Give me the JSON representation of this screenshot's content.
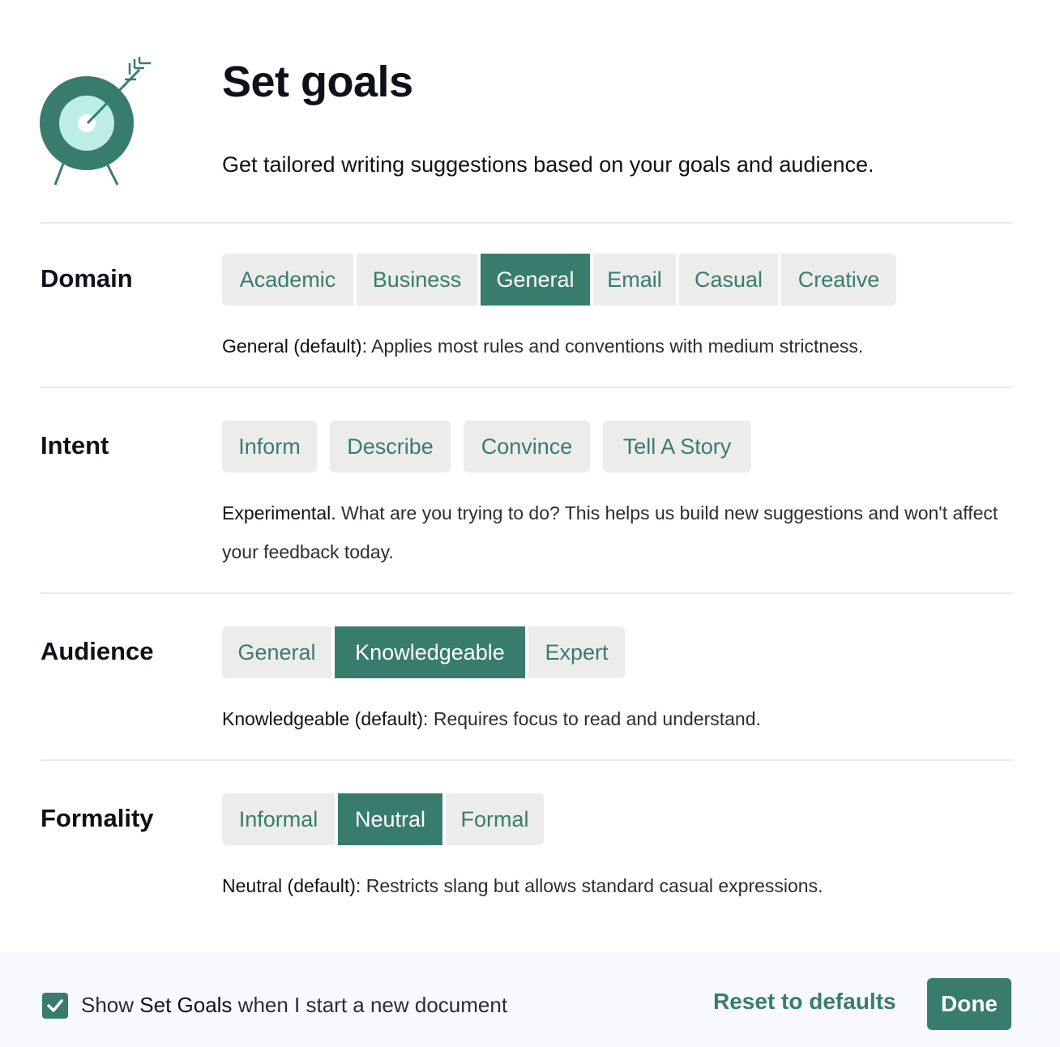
{
  "header": {
    "title": "Set goals",
    "subtitle": "Get tailored writing suggestions based on your goals and audience.",
    "logo_icon": "target-arrow-icon"
  },
  "colors": {
    "accent": "#387c6d",
    "accent_light": "#bdeee6",
    "option_bg": "#ececec",
    "footer_bg": "#f8f9fd",
    "text": "#0e101a"
  },
  "sections": {
    "domain": {
      "label": "Domain",
      "options": [
        "Academic",
        "Business",
        "General",
        "Email",
        "Casual",
        "Creative"
      ],
      "selected": "General",
      "desc_strong": "General (default):",
      "desc_text": " Applies most rules and conventions with medium strictness."
    },
    "intent": {
      "label": "Intent",
      "options": [
        "Inform",
        "Describe",
        "Convince",
        "Tell A Story"
      ],
      "selected": null,
      "desc_strong": "Experimental.",
      "desc_text": " What are you trying to do? This helps us build new suggestions and won't affect your feedback today."
    },
    "audience": {
      "label": "Audience",
      "options": [
        "General",
        "Knowledgeable",
        "Expert"
      ],
      "selected": "Knowledgeable",
      "desc_strong": "Knowledgeable (default):",
      "desc_text": " Requires focus to read and understand."
    },
    "formality": {
      "label": "Formality",
      "options": [
        "Informal",
        "Neutral",
        "Formal"
      ],
      "selected": "Neutral",
      "desc_strong": "Neutral (default):",
      "desc_text": " Restricts slang but allows standard casual expressions."
    }
  },
  "footer": {
    "checkbox_checked": true,
    "checkbox_label_pre": "Show ",
    "checkbox_label_strong": "Set Goals",
    "checkbox_label_post": " when I start a new document",
    "reset_label": "Reset to defaults",
    "done_label": "Done"
  }
}
